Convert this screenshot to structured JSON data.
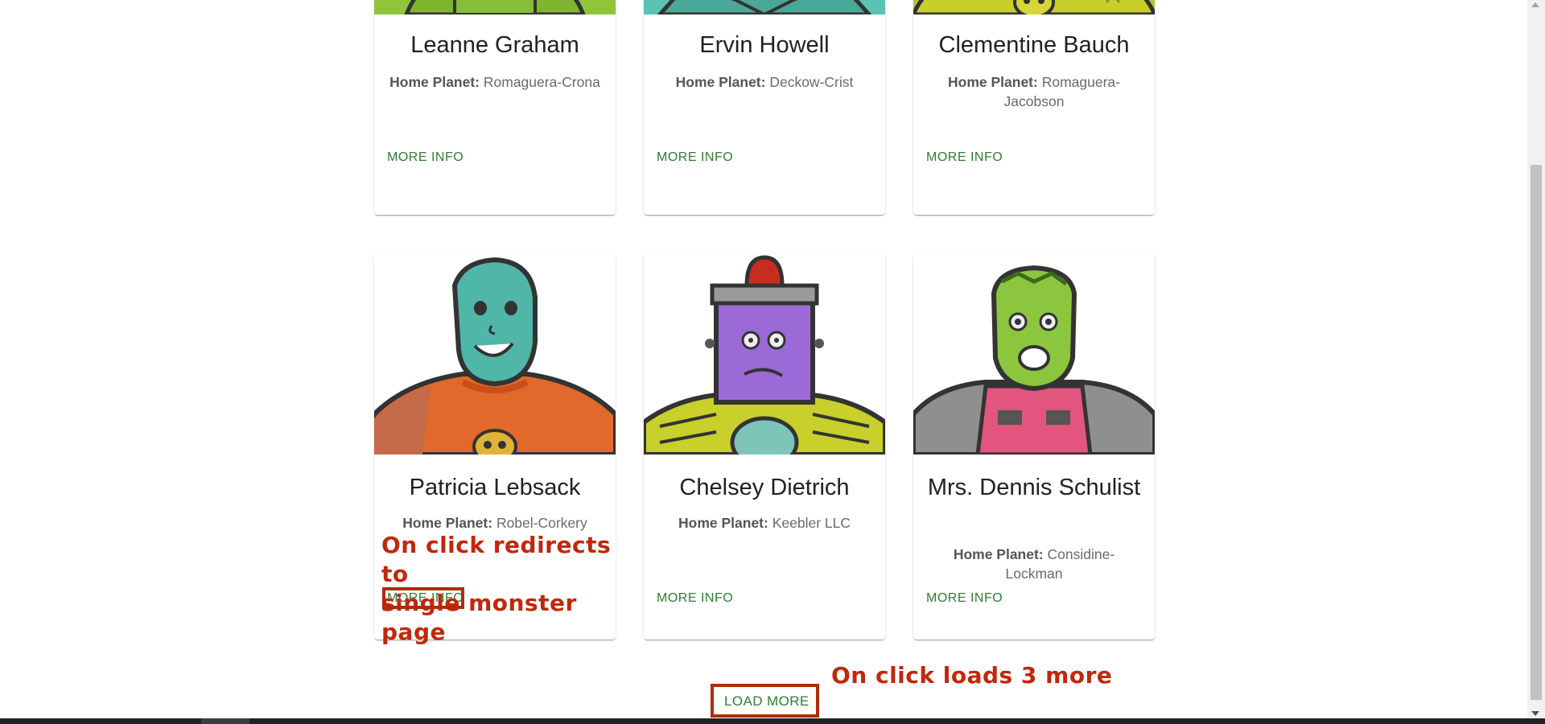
{
  "cards": [
    {
      "name": "Leanne Graham",
      "planet_label": "Home Planet:",
      "planet": "Romaguera-Crona",
      "action": "MORE INFO",
      "colors": {
        "skin": "#8fc43b",
        "bg": "#a6cf3a"
      }
    },
    {
      "name": "Ervin Howell",
      "planet_label": "Home Planet:",
      "planet": "Deckow-Crist",
      "action": "MORE INFO",
      "colors": {
        "skin": "#4dbfae",
        "bg": "#5cc2b3"
      }
    },
    {
      "name": "Clementine Bauch",
      "planet_label": "Home Planet:",
      "planet": "Romaguera-Jacobson",
      "action": "MORE INFO",
      "colors": {
        "skin": "#c8cf2a",
        "bg": "#b8c43a"
      }
    },
    {
      "name": "Patricia Lebsack",
      "planet_label": "Home Planet:",
      "planet": "Robel-Corkery",
      "action": "MORE INFO",
      "colors": {
        "skin": "#4fb6a8",
        "suit": "#e0692b"
      }
    },
    {
      "name": "Chelsey Dietrich",
      "planet_label": "Home Planet:",
      "planet": "Keebler LLC",
      "action": "MORE INFO",
      "colors": {
        "skin": "#9b6ad6",
        "suit": "#c9cf2b"
      }
    },
    {
      "name": "Mrs. Dennis Schulist",
      "planet_label": "Home Planet:",
      "planet": "Considine-Lockman",
      "action": "MORE INFO",
      "colors": {
        "skin": "#8cc63e",
        "suit": "#e2557f"
      }
    }
  ],
  "load_more": "LOAD MORE",
  "annotations": {
    "more_info_note": "On click redirects to single monster page",
    "more_info_note_line1": "On click redirects to",
    "more_info_note_line2": "single monster page",
    "load_more_note": "On click loads 3 more"
  },
  "theme": {
    "accent": "#2e7d32",
    "annotation": "#c0280c"
  }
}
